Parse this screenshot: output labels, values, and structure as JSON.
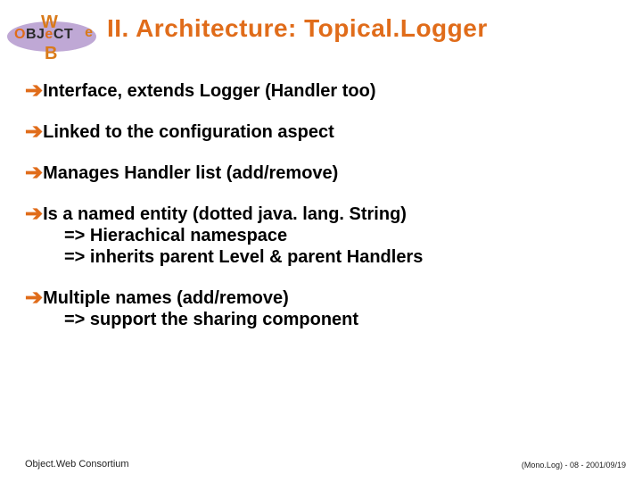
{
  "logo": {
    "w": "W",
    "e": "e",
    "b": "B",
    "obj": "OBJeCT"
  },
  "title": "II. Architecture: Topical.Logger",
  "bullets": {
    "b1": {
      "text": "Interface, extends Logger (Handler too)"
    },
    "b2": {
      "text": "Linked to the configuration aspect"
    },
    "b3": {
      "text": "Manages Handler list (add/remove)"
    },
    "b4": {
      "text": "Is a named entity (dotted java. lang. String)",
      "sub1": "=> Hierachical namespace",
      "sub2": "=> inherits parent Level & parent Handlers"
    },
    "b5": {
      "text": "Multiple names (add/remove)",
      "sub1": "=> support the sharing component"
    }
  },
  "footer": {
    "left": "Object.Web Consortium",
    "right": "(Mono.Log) - 08 - 2001/09/19"
  },
  "arrow_glyph": "è"
}
